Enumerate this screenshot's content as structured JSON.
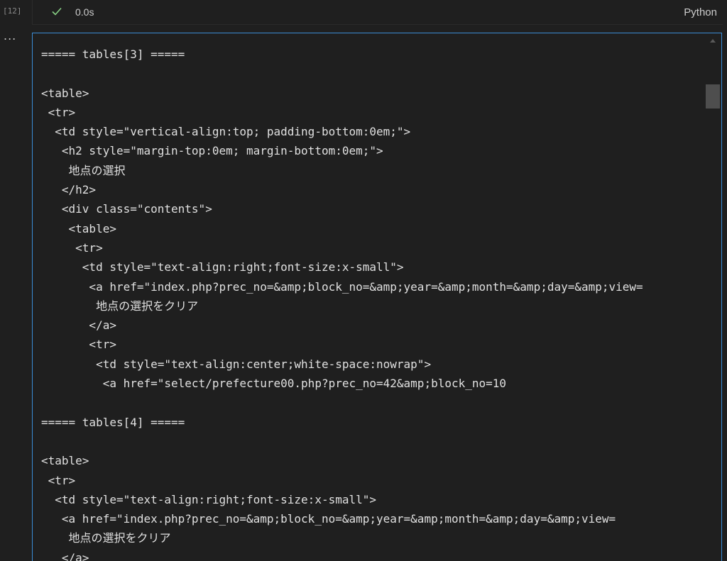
{
  "cell": {
    "exec_count": "[12]",
    "exec_time": "0.0s",
    "language": "Python",
    "more": "..."
  },
  "output": {
    "lines": [
      "===== tables[3] =====",
      "",
      "<table>",
      " <tr>",
      "  <td style=\"vertical-align:top; padding-bottom:0em;\">",
      "   <h2 style=\"margin-top:0em; margin-bottom:0em;\">",
      "    地点の選択",
      "   </h2>",
      "   <div class=\"contents\">",
      "    <table>",
      "     <tr>",
      "      <td style=\"text-align:right;font-size:x-small\">",
      "       <a href=\"index.php?prec_no=&amp;block_no=&amp;year=&amp;month=&amp;day=&amp;view=",
      "        地点の選択をクリア",
      "       </a>",
      "       <tr>",
      "        <td style=\"text-align:center;white-space:nowrap\">",
      "         <a href=\"select/prefecture00.php?prec_no=42&amp;block_no=10",
      "",
      "===== tables[4] =====",
      "",
      "<table>",
      " <tr>",
      "  <td style=\"text-align:right;font-size:x-small\">",
      "   <a href=\"index.php?prec_no=&amp;block_no=&amp;year=&amp;month=&amp;day=&amp;view=",
      "    地点の選択をクリア",
      "   </a>"
    ]
  },
  "colors": {
    "background": "#1f1f1f",
    "text": "#e0e0e0",
    "accent_border": "#3b8ed8",
    "success": "#89d185"
  }
}
